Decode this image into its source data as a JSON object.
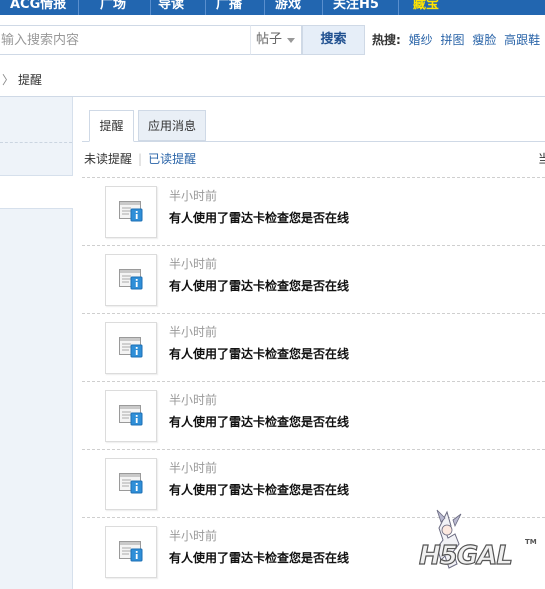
{
  "topnav": {
    "items": [
      "ACG情报",
      "广场",
      "导读",
      "广播",
      "游戏",
      "关注H5",
      "藏宝"
    ],
    "highlight_color": "#ffe400"
  },
  "search": {
    "placeholder": "输入搜索内容",
    "type_selected": "帖子",
    "button_label": "搜索",
    "hot_label": "热搜:",
    "hot_links": [
      "婚纱",
      "拼图",
      "瘦脸",
      "高跟鞋"
    ]
  },
  "breadcrumb": {
    "current": "提醒"
  },
  "tabs": {
    "active": "提醒",
    "other": "应用消息"
  },
  "filter": {
    "unread": "未读提醒",
    "read": "已读提醒",
    "right_fragment": "当"
  },
  "notices": [
    {
      "time": "半小时前",
      "message": "有人使用了雷达卡检查您是否在线"
    },
    {
      "time": "半小时前",
      "message": "有人使用了雷达卡检查您是否在线"
    },
    {
      "time": "半小时前",
      "message": "有人使用了雷达卡检查您是否在线"
    },
    {
      "time": "半小时前",
      "message": "有人使用了雷达卡检查您是否在线"
    },
    {
      "time": "半小时前",
      "message": "有人使用了雷达卡检查您是否在线"
    },
    {
      "time": "半小时前",
      "message": "有人使用了雷达卡检查您是否在线"
    }
  ],
  "logo": {
    "text": "H5GAL",
    "tm": "TM"
  },
  "colors": {
    "nav_bg": "#2266b0",
    "link": "#2a64a8",
    "sidebar_bg": "#eef3f9"
  }
}
